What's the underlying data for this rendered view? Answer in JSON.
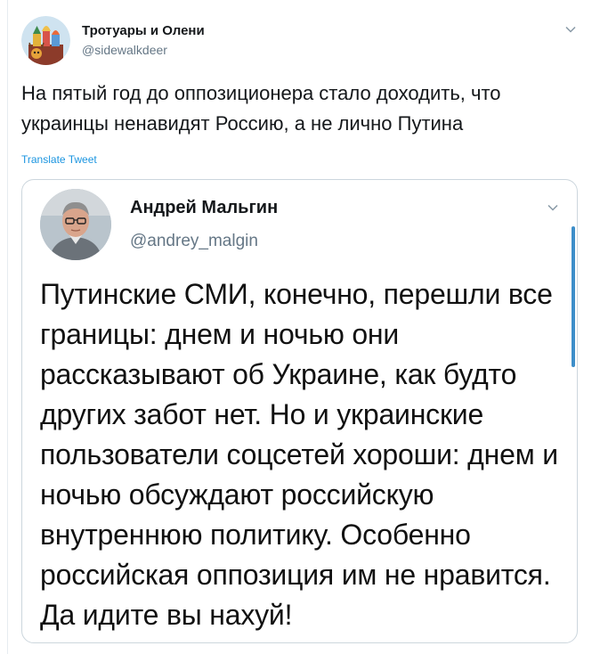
{
  "tweet": {
    "display_name": "Тротуары и Олени",
    "handle": "@sidewalkdeer",
    "text": "На пятый год до оппозиционера стало доходить, что украинцы ненавидят Россию, а не лично Путина",
    "translate_label": "Translate Tweet",
    "avatar_icon": "kremlin-avatar-icon",
    "menu_icon": "chevron-down-icon"
  },
  "quoted_tweet": {
    "display_name": "Андрей Мальгин",
    "handle": "@andrey_malgin",
    "text": "Путинские СМИ, конечно, перешли все границы: днем и ночью они рассказывают об Украине, как будто других забот нет. Но и украинские пользователи соцсетей хороши: днем и ночью обсуждают российскую внутреннюю политику. Особенно российская оппозиция им не нравится. Да идите вы нахуй!",
    "avatar_icon": "person-photo-avatar",
    "menu_icon": "chevron-down-icon"
  },
  "colors": {
    "accent": "#1b95e0",
    "secondary_text": "#657786",
    "border": "#ccd6dd"
  }
}
